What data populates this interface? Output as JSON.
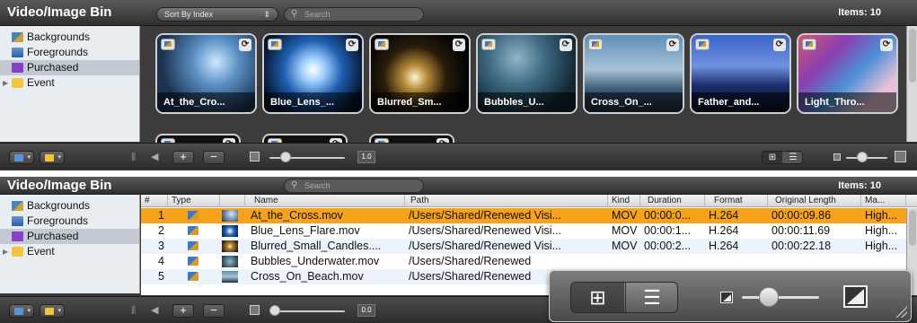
{
  "top_panel": {
    "title": "Video/Image Bin",
    "sort_label": "Sort By Index",
    "search_placeholder": "Search",
    "items_count": "Items: 10",
    "sidebar": [
      {
        "label": "Backgrounds",
        "icon": "backgrounds-icon"
      },
      {
        "label": "Foregrounds",
        "icon": "foregrounds-icon"
      },
      {
        "label": "Purchased",
        "icon": "purchased-icon",
        "selected": true
      },
      {
        "label": "Event",
        "icon": "folder-icon"
      }
    ],
    "thumbnails": [
      {
        "label": "At_the_Cro..."
      },
      {
        "label": "Blue_Lens_..."
      },
      {
        "label": "Blurred_Sm..."
      },
      {
        "label": "Bubbles_U..."
      },
      {
        "label": "Cross_On_..."
      },
      {
        "label": "Father_and..."
      },
      {
        "label": "Light_Thro..."
      }
    ],
    "zoom_value": "1.0",
    "add_symbol": "+",
    "remove_symbol": "−"
  },
  "bottom_panel": {
    "title": "Video/Image Bin",
    "search_placeholder": "Search",
    "items_count": "Items: 10",
    "sidebar": [
      {
        "label": "Backgrounds"
      },
      {
        "label": "Foregrounds"
      },
      {
        "label": "Purchased",
        "selected": true
      },
      {
        "label": "Event"
      }
    ],
    "columns": [
      "#",
      "Type",
      "Name",
      "Path",
      "Kind",
      "Duration",
      "Format",
      "Original Length",
      "Ma..."
    ],
    "rows": [
      {
        "num": "1",
        "name": "At_the_Cross.mov",
        "path": "/Users/Shared/Renewed Visi...",
        "kind": "MOV",
        "duration": "00:00:0...",
        "format": "H.264",
        "length": "00:00:09.86",
        "ma": "High..."
      },
      {
        "num": "2",
        "name": "Blue_Lens_Flare.mov",
        "path": "/Users/Shared/Renewed Visi...",
        "kind": "MOV",
        "duration": "00:00:1...",
        "format": "H.264",
        "length": "00:00:11.69",
        "ma": "High..."
      },
      {
        "num": "3",
        "name": "Blurred_Small_Candles....",
        "path": "/Users/Shared/Renewed Visi...",
        "kind": "MOV",
        "duration": "00:00:2...",
        "format": "H.264",
        "length": "00:00:22.18",
        "ma": "High..."
      },
      {
        "num": "4",
        "name": "Bubbles_Underwater.mov",
        "path": "/Users/Shared/Renewed",
        "kind": "",
        "duration": "",
        "format": "",
        "length": "",
        "ma": ""
      },
      {
        "num": "5",
        "name": "Cross_On_Beach.mov",
        "path": "/Users/Shared/Renewed",
        "kind": "",
        "duration": "",
        "format": "",
        "length": "",
        "ma": ""
      }
    ],
    "zoom_value": "0.0",
    "add_symbol": "+",
    "remove_symbol": "−"
  },
  "overlay": {
    "grid_view_icon": "grid-view-icon",
    "list_view_icon": "list-view-icon",
    "grid_glyph": "⊞",
    "list_glyph": "☰"
  },
  "colors": {
    "selected_row": "#f6a21b",
    "panel_dark": "#3a3a3a",
    "sidebar_bg": "#e8edf2"
  }
}
